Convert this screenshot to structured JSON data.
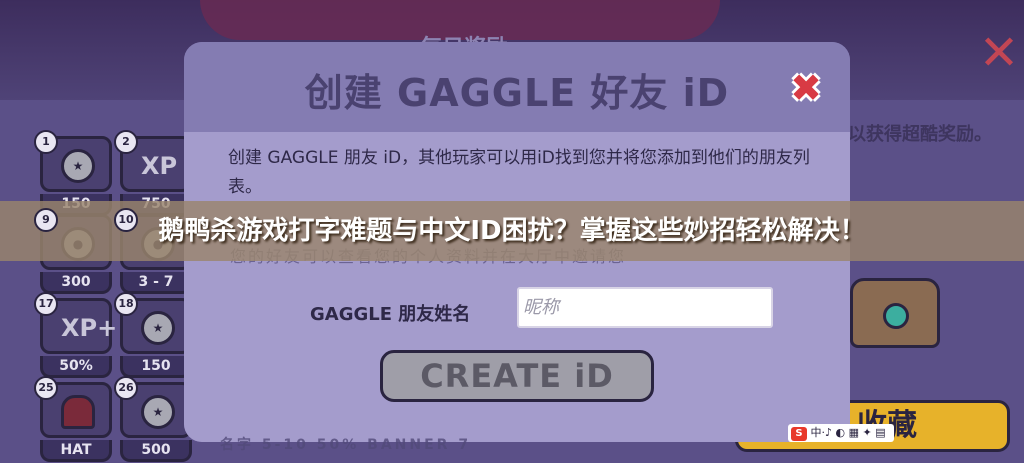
{
  "background": {
    "rewards_title": "每日奖励",
    "side_text": "以获得超酷奖励。",
    "collect_label": "收藏",
    "grid": [
      {
        "num": "1",
        "icon": "coin-icon",
        "icon_text": "",
        "value": "150"
      },
      {
        "num": "2",
        "icon": "xp-icon",
        "icon_text": "XP",
        "value": "750"
      },
      {
        "num": "9",
        "icon": "pet-icon",
        "icon_text": "",
        "value": "300"
      },
      {
        "num": "10",
        "icon": "pet-icon",
        "icon_text": "",
        "value": "3 - 7"
      },
      {
        "num": "17",
        "icon": "xp-plus-icon",
        "icon_text": "XP+",
        "value": "50%"
      },
      {
        "num": "18",
        "icon": "coin-icon",
        "icon_text": "",
        "value": "150"
      },
      {
        "num": "25",
        "icon": "hat-icon",
        "icon_text": "",
        "value": "HAT"
      },
      {
        "num": "26",
        "icon": "coin-stack-icon",
        "icon_text": "",
        "value": "500"
      }
    ],
    "blur_row": "名字   5-10   50%   BANNER   7"
  },
  "modal": {
    "title": "创建 GAGGLE 好友 iD",
    "description": "创建 GAGGLE 朋友 iD，其他玩家可以用iD找到您并将您添加到他们的朋友列表。",
    "blur_line": "您的好友可以查看您的个人资料并在大厅中邀请您",
    "name_label": "GAGGLE 朋友姓名",
    "name_placeholder": "昵称",
    "create_button": "CREATE iD"
  },
  "banner": {
    "text": "鹅鸭杀游戏打字难题与中文ID困扰？掌握这些妙招轻松解决！"
  },
  "ime": {
    "logo": "S",
    "text": "中·♪ ◐ ▦ ✦ ▤"
  },
  "colors": {
    "modal_bg": "#a49ccc",
    "modal_header": "#847cb2",
    "close_red": "#d83a44",
    "collect_yellow": "#e7b22a"
  }
}
